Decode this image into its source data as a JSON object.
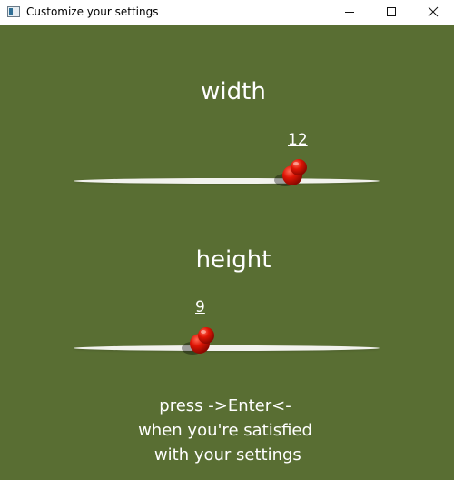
{
  "window": {
    "title": "Customize your settings"
  },
  "settings": {
    "width": {
      "label": "width",
      "value": "12"
    },
    "height": {
      "label": "height",
      "value": "9"
    }
  },
  "footer": {
    "line1": "press ->Enter<-",
    "line2": "when you're satisfied",
    "line3": " with your settings"
  },
  "colors": {
    "background": "#596e33",
    "track": "#f2f2ee",
    "thumb": "#cc1100"
  },
  "icons": {
    "app": "app-window-icon",
    "thumb": "red-pushpin-icon"
  }
}
